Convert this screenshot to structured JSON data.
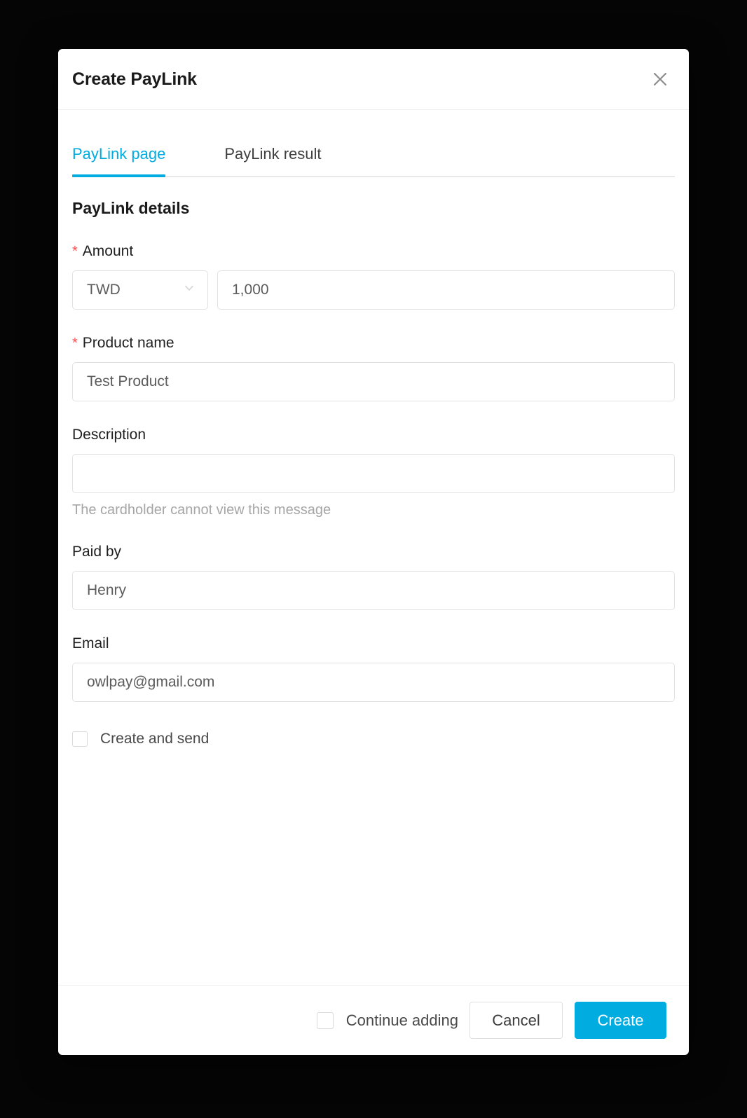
{
  "dialog": {
    "title": "Create PayLink",
    "close_icon": "close-icon"
  },
  "tabs": [
    {
      "label": "PayLink page",
      "active": true
    },
    {
      "label": "PayLink result",
      "active": false
    }
  ],
  "form": {
    "section_title": "PayLink details",
    "amount": {
      "label": "Amount",
      "required_marker": "*",
      "currency_value": "TWD",
      "currency_icon": "chevron-down-icon",
      "value": "1,000"
    },
    "product_name": {
      "label": "Product name",
      "required_marker": "*",
      "value": "Test Product"
    },
    "description": {
      "label": "Description",
      "value": "",
      "help_text": "The cardholder cannot view this message"
    },
    "paid_by": {
      "label": "Paid by",
      "value": "Henry"
    },
    "email": {
      "label": "Email",
      "value": "owlpay@gmail.com"
    },
    "create_and_send": {
      "label": "Create and send",
      "checked": false
    }
  },
  "footer": {
    "continue_adding_label": "Continue adding",
    "continue_adding_checked": false,
    "cancel_label": "Cancel",
    "create_label": "Create"
  },
  "colors": {
    "accent": "#00ace0",
    "required": "#ff4d4f",
    "border": "#e2e2e2",
    "text": "#1a1a1a",
    "muted": "#a6a6a6"
  }
}
